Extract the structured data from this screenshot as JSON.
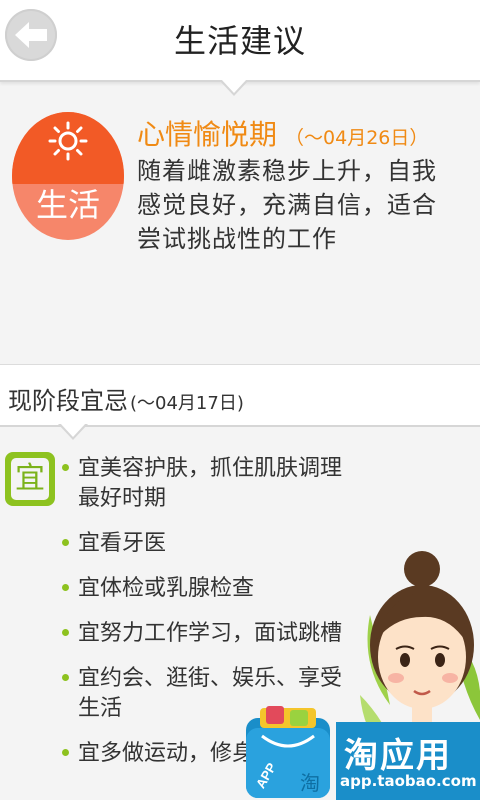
{
  "header": {
    "title": "生活建议",
    "back_icon": "back-arrow-icon"
  },
  "life": {
    "badge_label": "生活",
    "badge_icon": "sun-icon",
    "phase_title": "心情愉悦期",
    "phase_date": "（～04月26日）",
    "description": "随着雌激素稳步上升，自我感觉良好，充满自信，适合尝试挑战性的工作"
  },
  "dos": {
    "title": "现阶段宜忌",
    "date": "(～04月17日)",
    "badge": "宜",
    "items": [
      "宜美容护肤，抓住肌肤调理最好时期",
      "宜看牙医",
      "宜体检或乳腺检查",
      "宜努力工作学习，面试跳槽",
      "宜约会、逛街、娱乐、享受生活",
      "宜多做运动，修身"
    ]
  },
  "banner": {
    "app_icon_text": "APP",
    "app_icon_glyph": "淘",
    "brand_name": "淘应用",
    "brand_url": "app.taobao.com"
  },
  "colors": {
    "accent_orange": "#f08a14",
    "badge_red": "#f25a26",
    "badge_green": "#8dc21f",
    "banner_blue": "#1a8ec9"
  }
}
